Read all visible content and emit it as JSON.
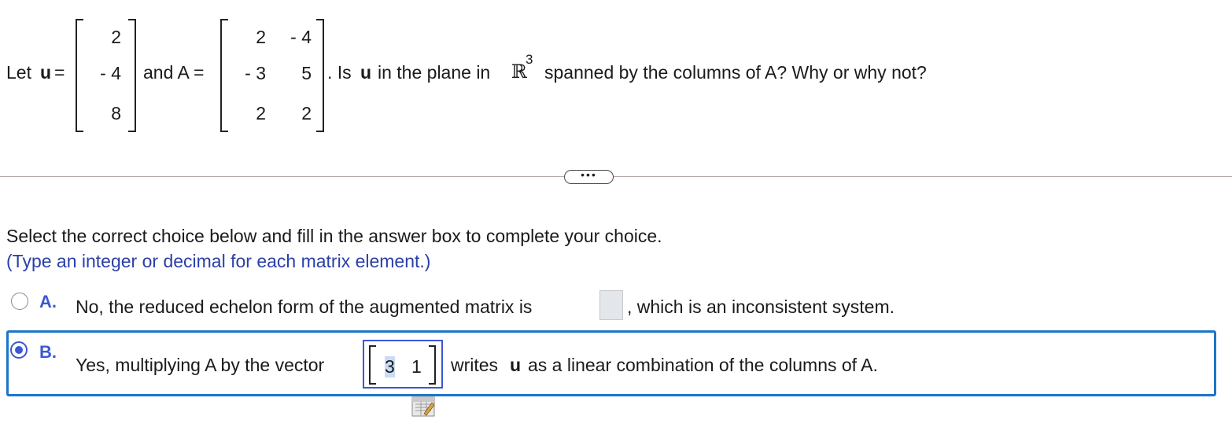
{
  "question": {
    "let_text": "Let",
    "u_symbol": "u",
    "equals": "=",
    "vector_u": [
      "2",
      "- 4",
      "8"
    ],
    "and_text": "and A =",
    "matrix_A": [
      [
        "2",
        "- 4"
      ],
      [
        "- 3",
        "5"
      ],
      [
        "2",
        "2"
      ]
    ],
    "prefix": ". Is",
    "u_inline": "u",
    "mid": "in the plane in",
    "R_symbol": "ℝ",
    "R_exp": "3",
    "suffix": "spanned by the columns of A? Why or why not?"
  },
  "divider": {
    "more_label": "•••"
  },
  "instructions": {
    "line1": "Select the correct choice below and fill in the answer box to complete your choice.",
    "line2": "(Type an integer or decimal for each matrix element.)"
  },
  "choices": {
    "a": {
      "letter": "A.",
      "text_before": "No, the reduced echelon form of the augmented matrix is",
      "text_after": ", which is an inconsistent system.",
      "selected": false
    },
    "b": {
      "letter": "B.",
      "text_before": "Yes, multiplying A by the vector",
      "answer_values": [
        "3",
        "1"
      ],
      "text_after_1": "writes",
      "u_bold": "u",
      "text_after_2": "as a linear combination of the columns of A.",
      "selected": true
    }
  },
  "colors": {
    "choice_letter": "#3c57d6",
    "instruction_blue": "#2a3fa8",
    "selected_frame": "#1b75c9",
    "divider": "#b9a8a8"
  },
  "icons": {
    "matrix_editor": "matrix-editor-icon"
  }
}
